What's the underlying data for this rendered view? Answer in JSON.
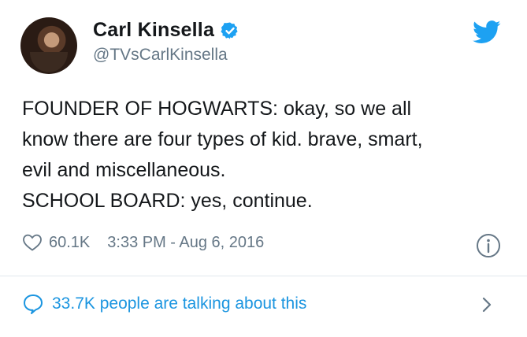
{
  "user": {
    "display_name": "Carl Kinsella",
    "handle": "@TVsCarlKinsella",
    "verified": true
  },
  "tweet": {
    "lines": [
      "FOUNDER OF HOGWARTS: okay, so we all",
      "know there are four types of kid. brave, smart,",
      "evil and miscellaneous.",
      "SCHOOL BOARD: yes, continue."
    ]
  },
  "meta": {
    "likes": "60.1K",
    "timestamp": "3:33 PM - Aug 6, 2016"
  },
  "footer": {
    "talking_text": "33.7K people are talking about this"
  },
  "colors": {
    "twitter_blue": "#1da1f2",
    "link_blue": "#1b95e0",
    "secondary_text": "#657786"
  },
  "icons": [
    "avatar",
    "verified-badge-icon",
    "twitter-bird-icon",
    "heart-icon",
    "info-icon",
    "speech-bubble-icon",
    "chevron-right-icon"
  ]
}
